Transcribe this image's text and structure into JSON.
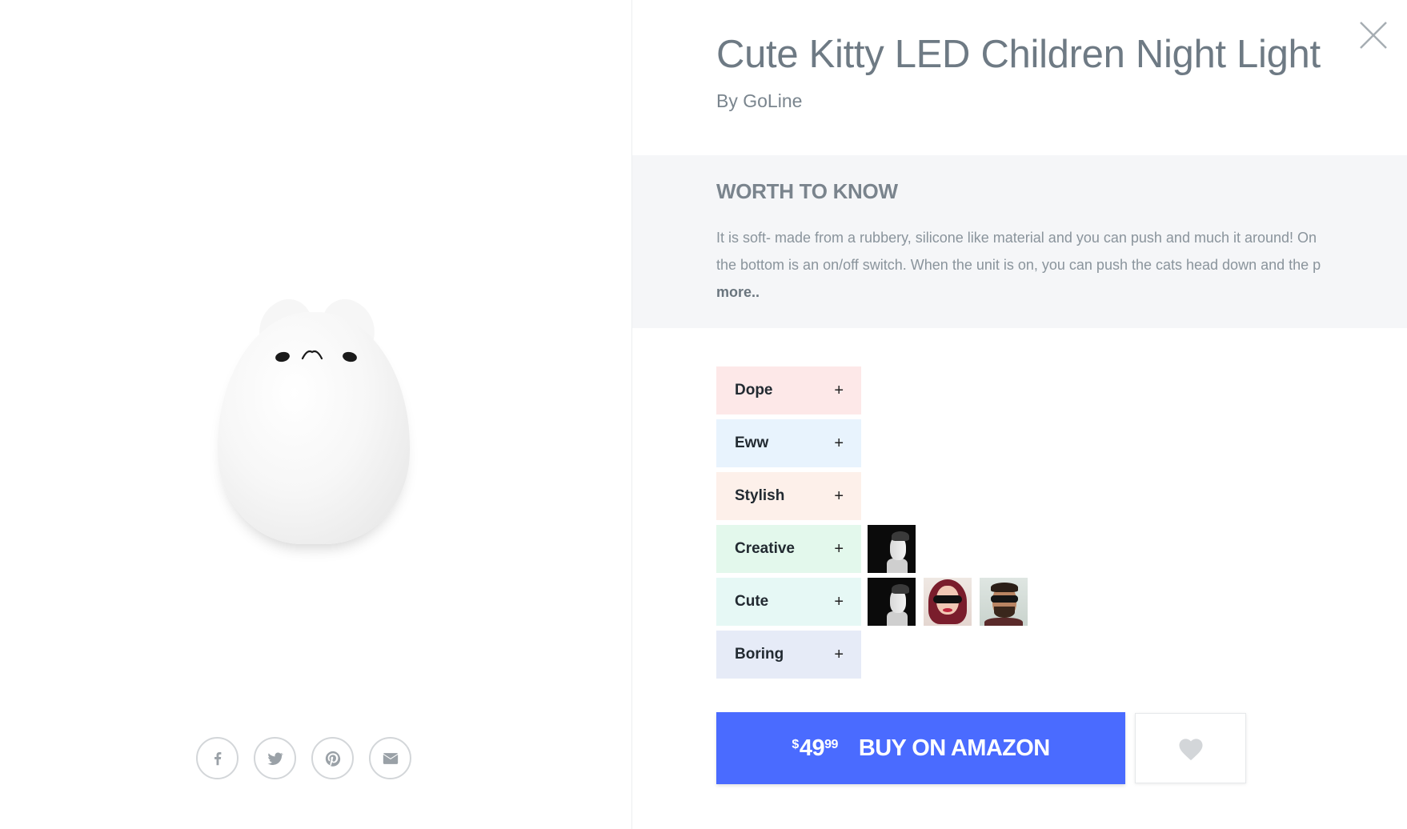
{
  "product": {
    "title": "Cute Kitty LED Children Night Light",
    "brand_line": "By GoLine"
  },
  "worth_to_know": {
    "heading": "WORTH TO KNOW",
    "text": "It is soft- made from a rubbery, silicone like material and you can push and much it around! On the bottom is an on/off switch. When the unit is on, you can push the cats head down and the p ",
    "more_label": "more.."
  },
  "tags": [
    {
      "label": "Dope",
      "plus": "+",
      "color": "#fde8e8",
      "avatars": []
    },
    {
      "label": "Eww",
      "plus": "+",
      "color": "#e8f3fd",
      "avatars": []
    },
    {
      "label": "Stylish",
      "plus": "+",
      "color": "#fdf0ea",
      "avatars": []
    },
    {
      "label": "Creative",
      "plus": "+",
      "color": "#e3f8ec",
      "avatars": [
        "avatar-bw"
      ]
    },
    {
      "label": "Cute",
      "plus": "+",
      "color": "#e6f8f5",
      "avatars": [
        "avatar-bw",
        "avatar-girl",
        "avatar-guy"
      ]
    },
    {
      "label": "Boring",
      "plus": "+",
      "color": "#e6ebf7",
      "avatars": []
    }
  ],
  "buy": {
    "price_symbol": "$",
    "price_int": "49",
    "price_dec": "99",
    "label": "BUY ON AMAZON",
    "color": "#4a6bff"
  },
  "share": [
    {
      "name": "facebook-share-button",
      "icon": "facebook-icon"
    },
    {
      "name": "twitter-share-button",
      "icon": "twitter-icon"
    },
    {
      "name": "pinterest-share-button",
      "icon": "pinterest-icon"
    },
    {
      "name": "email-share-button",
      "icon": "email-icon"
    }
  ],
  "icons": {
    "close": "close-icon",
    "favorite": "heart-icon"
  }
}
